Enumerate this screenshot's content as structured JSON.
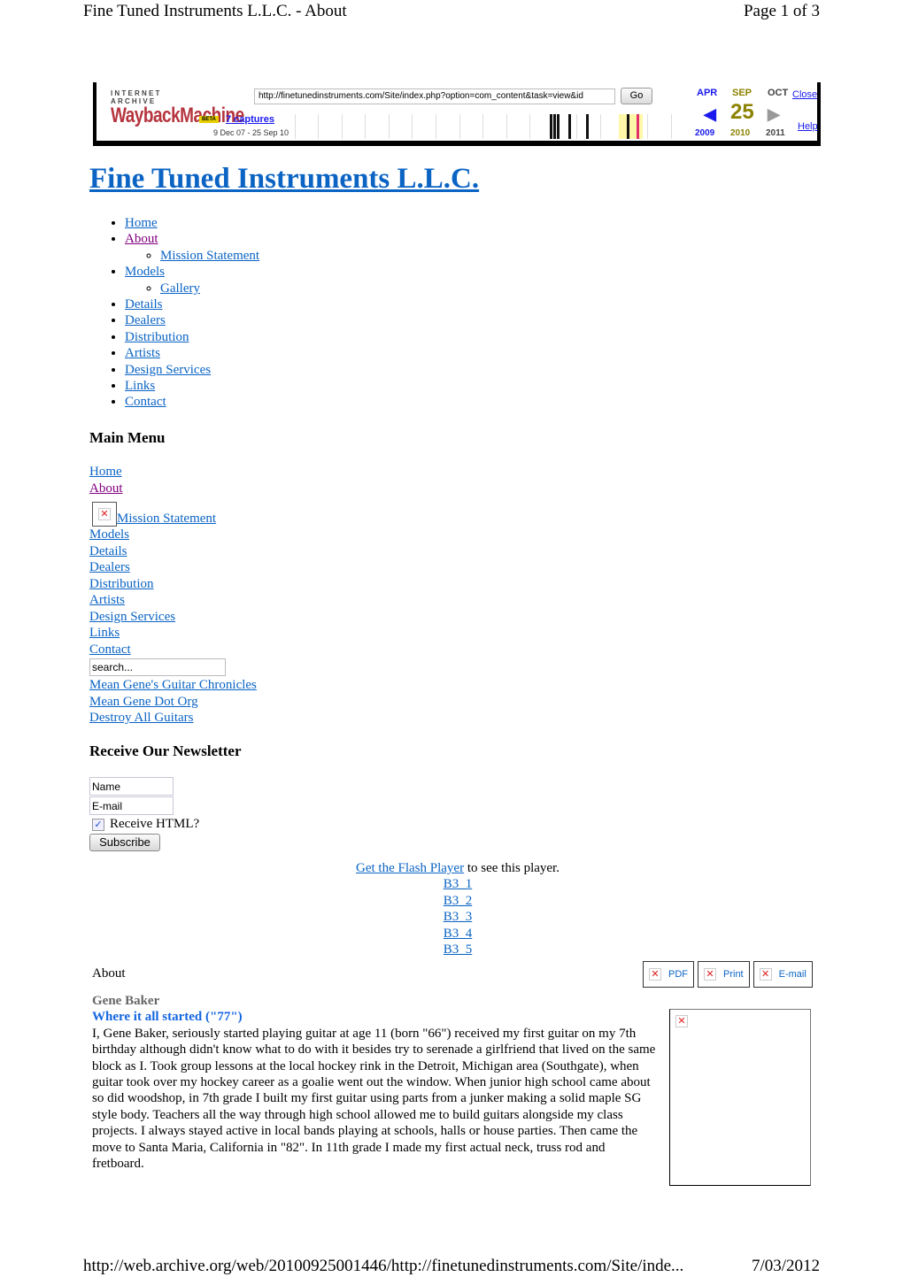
{
  "print_header": {
    "title": "Fine Tuned Instruments L.L.C. - About",
    "page": "Page 1 of 3"
  },
  "print_footer": {
    "url": "http://web.archive.org/web/20100925001446/http://finetunedinstruments.com/Site/inde...",
    "date": "7/03/2012"
  },
  "wayback": {
    "logo_top": "INTERNET ARCHIVE",
    "logo_main": "WaybackMachine",
    "logo_beta": "BETA",
    "url_value": "http://finetunedinstruments.com/Site/index.php?option=com_content&task=view&id",
    "go_label": "Go",
    "captures": "7 captures",
    "range": "9 Dec 07 - 25 Sep 10",
    "prev_month": "APR",
    "cur_month": "SEP",
    "next_month": "OCT",
    "cur_day": "25",
    "prev_year": "2009",
    "cur_year": "2010",
    "next_year": "2011",
    "close_label": "Close",
    "help_label": "Help",
    "colors": {
      "prev": "#1a1aee",
      "current": "#8c8200",
      "next": "#444444",
      "highlight": "#fff7a8",
      "capture": "#111111",
      "selected": "#e0306a"
    }
  },
  "site_title": "Fine Tuned Instruments L.L.C.",
  "nav": {
    "items": [
      {
        "label": "Home"
      },
      {
        "label": "About",
        "visited": true,
        "children": [
          {
            "label": "Mission Statement"
          }
        ]
      },
      {
        "label": "Models",
        "children": [
          {
            "label": "Gallery"
          }
        ]
      },
      {
        "label": "Details"
      },
      {
        "label": "Dealers"
      },
      {
        "label": "Distribution"
      },
      {
        "label": "Artists"
      },
      {
        "label": "Design Services"
      },
      {
        "label": "Links"
      },
      {
        "label": "Contact"
      }
    ]
  },
  "main_menu": {
    "heading": "Main Menu",
    "items": [
      "Home",
      "About",
      "Mission Statement",
      "Models",
      "Details",
      "Dealers",
      "Distribution",
      "Artists",
      "Design Services",
      "Links",
      "Contact"
    ],
    "search_placeholder": "search...",
    "extra_links": [
      "Mean Gene's Guitar Chronicles",
      "Mean Gene Dot Org",
      "Destroy All Guitars"
    ]
  },
  "newsletter": {
    "heading": "Receive Our Newsletter",
    "name_value": "Name",
    "email_value": "E-mail",
    "html_label": "Receive HTML?",
    "html_checked": true,
    "subscribe_label": "Subscribe"
  },
  "flash": {
    "link_label": "Get the Flash Player",
    "suffix": " to see this player.",
    "tracks": [
      "B3_1",
      "B3_2",
      "B3_3",
      "B3_4",
      "B3_5"
    ]
  },
  "content": {
    "heading": "About",
    "tools": [
      "PDF",
      "Print",
      "E-mail"
    ],
    "author": "Gene Baker",
    "subtitle": "Where it all started (\"77\")",
    "body": "I, Gene Baker, seriously started playing guitar at age 11 (born \"66\") received my first guitar on my 7th birthday although didn't know what to do with it besides try to serenade a girlfriend that lived on the same block as I. Took group lessons at the local hockey rink in the Detroit, Michigan area (Southgate), when guitar took over my hockey career as a goalie went out the window. When junior high school came about so did woodshop, in 7th grade I built my first guitar using parts from a junker making a solid maple SG style body. Teachers all the way through high school allowed me to build guitars alongside my class projects. I always stayed active in local bands playing at schools, halls or house parties. Then came the move to Santa Maria, California in \"82\". In 11th grade I made my first actual neck, truss rod and fretboard."
  }
}
